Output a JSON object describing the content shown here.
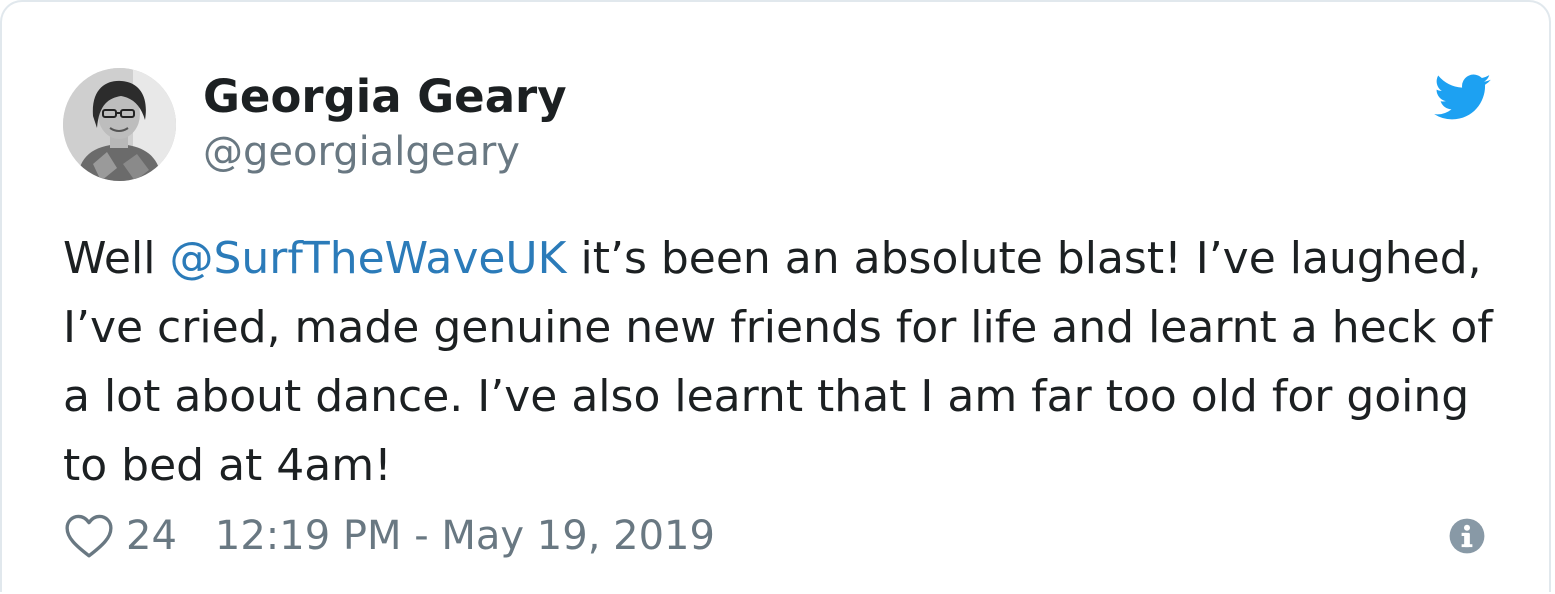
{
  "author": {
    "display_name": "Georgia Geary",
    "handle": "@georgialgeary"
  },
  "tweet": {
    "text_before": "Well ",
    "mention": "@SurfTheWaveUK",
    "text_after": " it’s been an absolute blast! I’ve laughed, I’ve cried, made genuine new friends for life and learnt a heck of a lot about dance. I’ve also learnt that I am far too old for going to bed at 4am!"
  },
  "footer": {
    "likes": "24",
    "timestamp": "12:19 PM - May 19, 2019"
  },
  "icons": {
    "brand": "twitter-bird-icon",
    "like": "heart-icon",
    "info": "info-icon"
  },
  "colors": {
    "text": "#1c2022",
    "secondary": "#697882",
    "mention": "#2b7bb9",
    "twitter_blue": "#1da1f2",
    "border": "#e1e8ed"
  }
}
